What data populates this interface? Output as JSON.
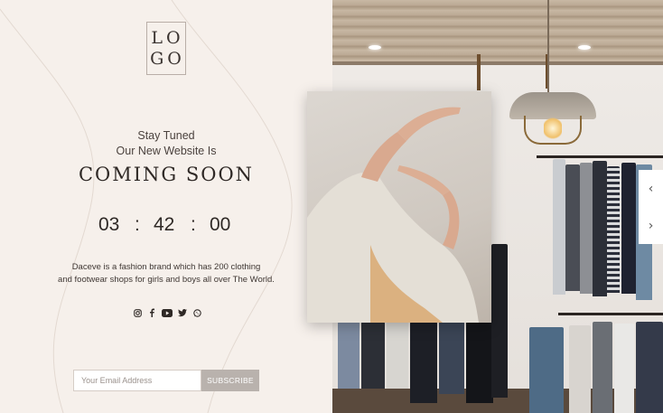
{
  "brand": {
    "logo_line1": "LO",
    "logo_line2": "GO"
  },
  "hero": {
    "tagline_line1": "Stay Tuned",
    "tagline_line2": "Our New Website Is",
    "headline": "COMING SOON"
  },
  "countdown": {
    "hours": "03",
    "minutes": "42",
    "seconds": "00",
    "separator": ":"
  },
  "description": {
    "line1": "Daceve is a fashion brand which has 200 clothing",
    "line2": "and footwear shops for girls and boys all over The World."
  },
  "social": {
    "icons": [
      "instagram-icon",
      "facebook-icon",
      "youtube-icon",
      "twitter-icon",
      "whatsapp-icon"
    ]
  },
  "newsletter": {
    "email_placeholder": "Your Email Address",
    "email_value": "",
    "subscribe_label": "SUBSCRIBE"
  },
  "slider": {
    "prev_glyph": "‹",
    "next_glyph": "›"
  },
  "colors": {
    "panel_bg": "#f6f0eb",
    "button_bg": "#b9b2ad",
    "text_dark": "#2f2926"
  }
}
